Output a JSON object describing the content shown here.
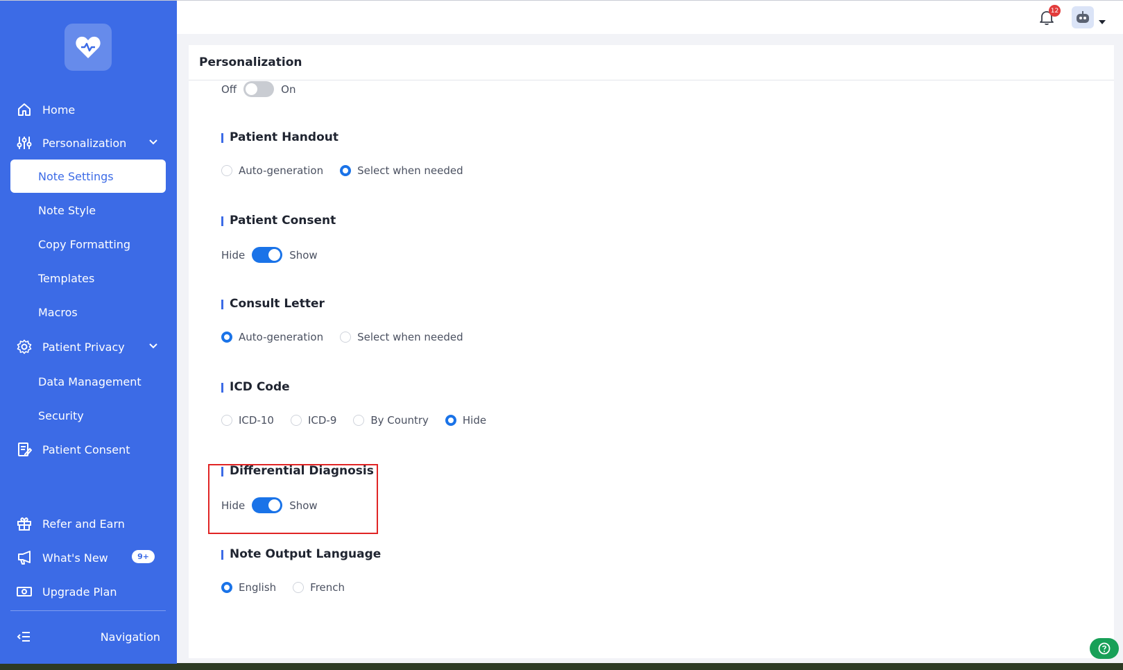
{
  "sidebar": {
    "items": [
      {
        "label": "Home"
      },
      {
        "label": "Personalization"
      },
      {
        "label": "Note Settings"
      },
      {
        "label": "Note Style"
      },
      {
        "label": "Copy Formatting"
      },
      {
        "label": "Templates"
      },
      {
        "label": "Macros"
      },
      {
        "label": "Patient Privacy"
      },
      {
        "label": "Data Management"
      },
      {
        "label": "Security"
      },
      {
        "label": "Patient Consent"
      },
      {
        "label": "Refer and Earn"
      },
      {
        "label": "What's New",
        "badge": "9+"
      },
      {
        "label": "Upgrade Plan"
      }
    ],
    "navigation_label": "Navigation"
  },
  "topbar": {
    "notification_count": "12"
  },
  "page": {
    "title": "Personalization",
    "top_toggle": {
      "off_label": "Off",
      "on_label": "On",
      "state": "off"
    },
    "sections": {
      "patient_handout": {
        "title": "Patient Handout",
        "options": [
          "Auto-generation",
          "Select when needed"
        ],
        "selected": "Select when needed"
      },
      "patient_consent": {
        "title": "Patient Consent",
        "left": "Hide",
        "right": "Show",
        "state": "on"
      },
      "consult_letter": {
        "title": "Consult Letter",
        "options": [
          "Auto-generation",
          "Select when needed"
        ],
        "selected": "Auto-generation"
      },
      "icd_code": {
        "title": "ICD Code",
        "options": [
          "ICD-10",
          "ICD-9",
          "By Country",
          "Hide"
        ],
        "selected": "Hide"
      },
      "differential_diagnosis": {
        "title": "Differential Diagnosis",
        "left": "Hide",
        "right": "Show",
        "state": "on"
      },
      "note_output_language": {
        "title": "Note Output Language",
        "options": [
          "English",
          "French"
        ],
        "selected": "English"
      }
    }
  },
  "colors": {
    "sidebar": "#3c6be6",
    "accent": "#1a73e8",
    "highlight": "#e02424",
    "help": "#18a058"
  }
}
